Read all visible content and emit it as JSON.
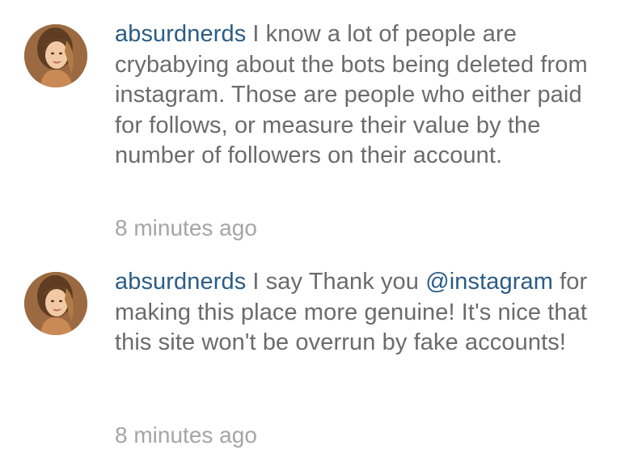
{
  "comments": [
    {
      "username": "absurdnerds",
      "text_before_mention": "I know a lot of people are crybabying about the bots being deleted from instagram. Those are people who either paid for follows, or measure their value by the number of followers on their account.",
      "mention": "",
      "text_after_mention": "",
      "timestamp": "8 minutes ago"
    },
    {
      "username": "absurdnerds",
      "text_before_mention": "I  say Thank you ",
      "mention": "@instagram",
      "text_after_mention": " for making this place more genuine! It's nice that this site won't be overrun by fake accounts!",
      "timestamp": "8 minutes ago"
    }
  ],
  "colors": {
    "username": "#2b5c86",
    "body_text": "#6b6b6b",
    "timestamp": "#a5a5a5",
    "mention": "#2b5c86"
  },
  "icons": {
    "avatar": "profile-photo"
  }
}
